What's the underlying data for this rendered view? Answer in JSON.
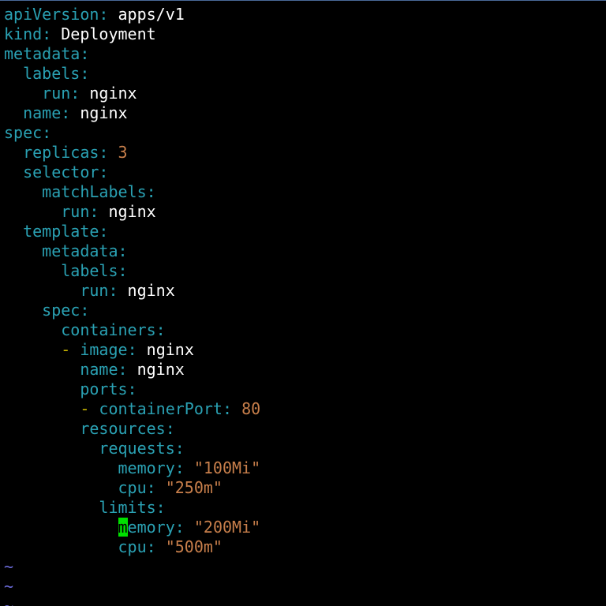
{
  "colors": {
    "background": "#000000",
    "key": "#2aa1b3",
    "scalar": "#ffffff",
    "number_string": "#c87f4b",
    "sequence_dash": "#c7b400",
    "cursor": "#00e000",
    "empty_line_marker": "#6a6ad8"
  },
  "editor": {
    "lines": [
      {
        "indent": "",
        "dash": "",
        "key": "apiVersion",
        "value": "apps/v1",
        "value_type": "scalar"
      },
      {
        "indent": "",
        "dash": "",
        "key": "kind",
        "value": "Deployment",
        "value_type": "scalar"
      },
      {
        "indent": "",
        "dash": "",
        "key": "metadata",
        "value": "",
        "value_type": "none"
      },
      {
        "indent": "  ",
        "dash": "",
        "key": "labels",
        "value": "",
        "value_type": "none"
      },
      {
        "indent": "    ",
        "dash": "",
        "key": "run",
        "value": "nginx",
        "value_type": "scalar"
      },
      {
        "indent": "  ",
        "dash": "",
        "key": "name",
        "value": "nginx",
        "value_type": "scalar"
      },
      {
        "indent": "",
        "dash": "",
        "key": "spec",
        "value": "",
        "value_type": "none"
      },
      {
        "indent": "  ",
        "dash": "",
        "key": "replicas",
        "value": "3",
        "value_type": "number"
      },
      {
        "indent": "  ",
        "dash": "",
        "key": "selector",
        "value": "",
        "value_type": "none"
      },
      {
        "indent": "    ",
        "dash": "",
        "key": "matchLabels",
        "value": "",
        "value_type": "none"
      },
      {
        "indent": "      ",
        "dash": "",
        "key": "run",
        "value": "nginx",
        "value_type": "scalar"
      },
      {
        "indent": "  ",
        "dash": "",
        "key": "template",
        "value": "",
        "value_type": "none"
      },
      {
        "indent": "    ",
        "dash": "",
        "key": "metadata",
        "value": "",
        "value_type": "none"
      },
      {
        "indent": "      ",
        "dash": "",
        "key": "labels",
        "value": "",
        "value_type": "none"
      },
      {
        "indent": "        ",
        "dash": "",
        "key": "run",
        "value": "nginx",
        "value_type": "scalar"
      },
      {
        "indent": "    ",
        "dash": "",
        "key": "spec",
        "value": "",
        "value_type": "none"
      },
      {
        "indent": "      ",
        "dash": "",
        "key": "containers",
        "value": "",
        "value_type": "none"
      },
      {
        "indent": "      ",
        "dash": "- ",
        "key": "image",
        "value": "nginx",
        "value_type": "scalar"
      },
      {
        "indent": "        ",
        "dash": "",
        "key": "name",
        "value": "nginx",
        "value_type": "scalar"
      },
      {
        "indent": "        ",
        "dash": "",
        "key": "ports",
        "value": "",
        "value_type": "none"
      },
      {
        "indent": "        ",
        "dash": "- ",
        "key": "containerPort",
        "value": "80",
        "value_type": "number"
      },
      {
        "indent": "        ",
        "dash": "",
        "key": "resources",
        "value": "",
        "value_type": "none"
      },
      {
        "indent": "          ",
        "dash": "",
        "key": "requests",
        "value": "",
        "value_type": "none"
      },
      {
        "indent": "            ",
        "dash": "",
        "key": "memory",
        "value": "\"100Mi\"",
        "value_type": "string"
      },
      {
        "indent": "            ",
        "dash": "",
        "key": "cpu",
        "value": "\"250m\"",
        "value_type": "string"
      },
      {
        "indent": "          ",
        "dash": "",
        "key": "limits",
        "value": "",
        "value_type": "none"
      },
      {
        "indent": "            ",
        "dash": "",
        "key": "memory",
        "value": "\"200Mi\"",
        "value_type": "string",
        "cursor": true
      },
      {
        "indent": "            ",
        "dash": "",
        "key": "cpu",
        "value": "\"500m\"",
        "value_type": "string"
      }
    ],
    "empty_line_markers": [
      "~",
      "~",
      "~"
    ]
  }
}
